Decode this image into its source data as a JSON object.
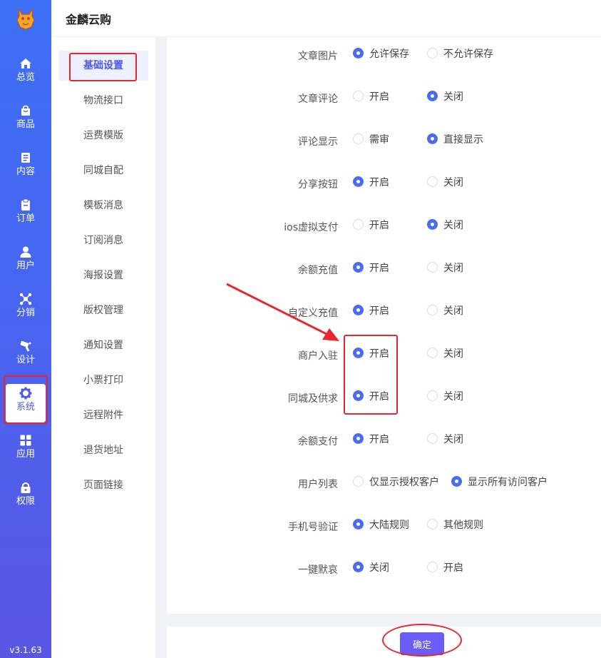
{
  "app": {
    "title": "金麟云购",
    "version": "v3.1.63"
  },
  "nav": [
    {
      "label": "总览",
      "icon": "home-icon"
    },
    {
      "label": "商品",
      "icon": "bag-icon"
    },
    {
      "label": "内容",
      "icon": "document-icon"
    },
    {
      "label": "订单",
      "icon": "clipboard-icon"
    },
    {
      "label": "用户",
      "icon": "user-icon"
    },
    {
      "label": "分销",
      "icon": "network-icon"
    },
    {
      "label": "设计",
      "icon": "brush-icon"
    },
    {
      "label": "系统",
      "icon": "gear-icon",
      "active": true
    },
    {
      "label": "应用",
      "icon": "grid-icon"
    },
    {
      "label": "权限",
      "icon": "lock-icon"
    }
  ],
  "submenu": [
    {
      "label": "基础设置",
      "active": true
    },
    {
      "label": "物流接口"
    },
    {
      "label": "运费模版"
    },
    {
      "label": "同城自配"
    },
    {
      "label": "模板消息"
    },
    {
      "label": "订阅消息"
    },
    {
      "label": "海报设置"
    },
    {
      "label": "版权管理"
    },
    {
      "label": "通知设置"
    },
    {
      "label": "小票打印"
    },
    {
      "label": "远程附件"
    },
    {
      "label": "退货地址"
    },
    {
      "label": "页面链接"
    }
  ],
  "settings": [
    {
      "label": "文章图片",
      "options": [
        "允许保存",
        "不允许保存"
      ],
      "selected": 0
    },
    {
      "label": "文章评论",
      "options": [
        "开启",
        "关闭"
      ],
      "selected": 1
    },
    {
      "label": "评论显示",
      "options": [
        "需审",
        "直接显示"
      ],
      "selected": 1
    },
    {
      "label": "分享按钮",
      "options": [
        "开启",
        "关闭"
      ],
      "selected": 0
    },
    {
      "label": "ios虚拟支付",
      "options": [
        "开启",
        "关闭"
      ],
      "selected": 1
    },
    {
      "label": "余额充值",
      "options": [
        "开启",
        "关闭"
      ],
      "selected": 0
    },
    {
      "label": "自定义充值",
      "options": [
        "开启",
        "关闭"
      ],
      "selected": 0
    },
    {
      "label": "商户入驻",
      "options": [
        "开启",
        "关闭"
      ],
      "selected": 0
    },
    {
      "label": "同城及供求",
      "options": [
        "开启",
        "关闭"
      ],
      "selected": 0
    },
    {
      "label": "余额支付",
      "options": [
        "开启",
        "关闭"
      ],
      "selected": 0
    },
    {
      "label": "用户列表",
      "options": [
        "仅显示授权客户",
        "显示所有访问客户"
      ],
      "selected": 1
    },
    {
      "label": "手机号验证",
      "options": [
        "大陆规则",
        "其他规则"
      ],
      "selected": 0
    },
    {
      "label": "一键默哀",
      "options": [
        "关闭",
        "开启"
      ],
      "selected": 0
    }
  ],
  "actions": {
    "confirm_label": "确定"
  },
  "colors": {
    "accent": "#4a6cf0",
    "button": "#6b5cf6",
    "annotation": "#e8262b"
  }
}
